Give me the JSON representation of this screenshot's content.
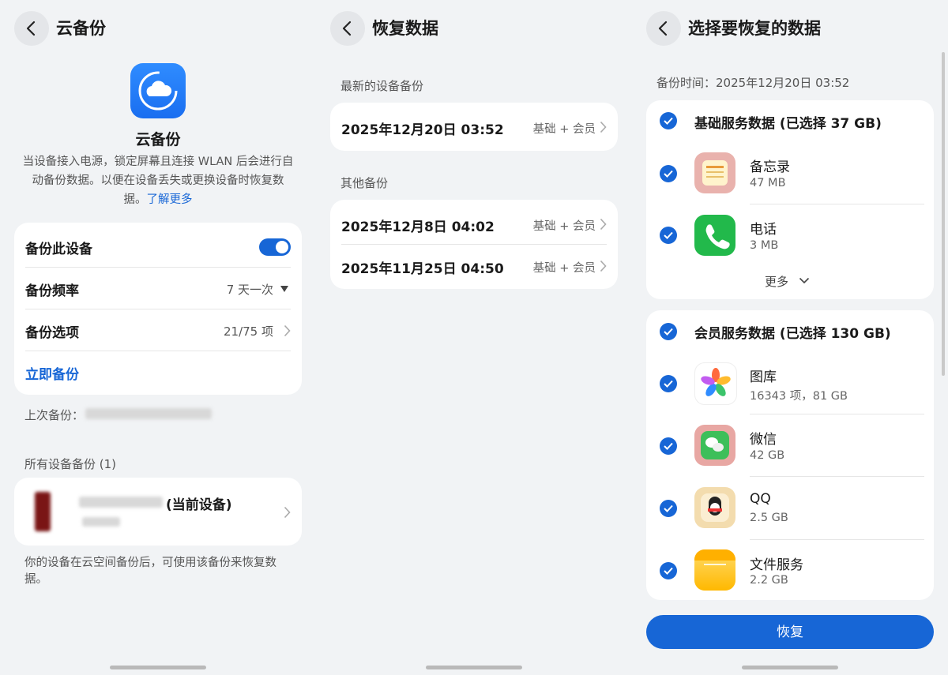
{
  "panel1": {
    "title": "云备份",
    "app_name": "云备份",
    "description": "当设备接入电源，锁定屏幕且连接 WLAN 后会进行自动备份数据。以便在设备丢失或更换设备时恢复数据。",
    "learn_more": "了解更多",
    "backup_device_label": "备份此设备",
    "backup_toggle_on": true,
    "frequency_label": "备份频率",
    "frequency_value": "7 天一次",
    "options_label": "备份选项",
    "options_value": "21/75 项",
    "backup_now": "立即备份",
    "last_backup_label": "上次备份：",
    "all_devices_label": "所有设备备份 (1)",
    "current_device_suffix": "(当前设备)",
    "footer_note": "你的设备在云空间备份后，可使用该备份来恢复数据。"
  },
  "panel2": {
    "title": "恢复数据",
    "latest_label": "最新的设备备份",
    "latest": {
      "date": "2025年12月20日 03:52",
      "tag": "基础 + 会员"
    },
    "other_label": "其他备份",
    "others": [
      {
        "date": "2025年12月8日 04:02",
        "tag": "基础 + 会员"
      },
      {
        "date": "2025年11月25日 04:50",
        "tag": "基础 + 会员"
      }
    ]
  },
  "panel3": {
    "title": "选择要恢复的数据",
    "backup_time": "备份时间：2025年12月20日 03:52",
    "basic_group": "基础服务数据 (已选择 37 GB)",
    "basic_items": [
      {
        "name": "备忘录",
        "size": "47 MB",
        "icon": "notes-icon"
      },
      {
        "name": "电话",
        "size": "3 MB",
        "icon": "phone-icon"
      }
    ],
    "more": "更多",
    "member_group": "会员服务数据 (已选择 130 GB)",
    "member_items": [
      {
        "name": "图库",
        "size": "16343 项，81 GB",
        "icon": "gallery-icon"
      },
      {
        "name": "微信",
        "size": "42 GB",
        "icon": "wechat-icon"
      },
      {
        "name": "QQ",
        "size": "2.5 GB",
        "icon": "qq-icon"
      },
      {
        "name": "文件服务",
        "size": "2.2 GB",
        "icon": "files-icon"
      }
    ],
    "restore": "恢复"
  },
  "colors": {
    "accent": "#1766d6",
    "background": "#f1f3f5",
    "card": "#ffffff"
  }
}
